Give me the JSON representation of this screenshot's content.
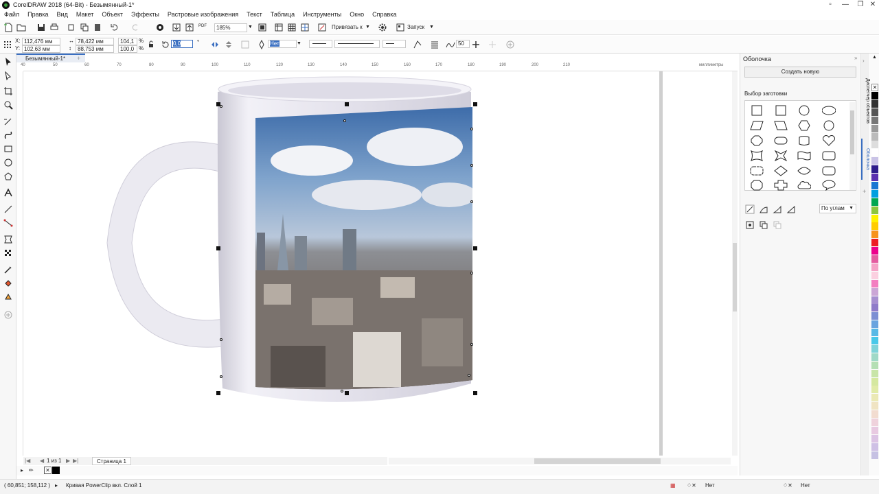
{
  "window": {
    "title": "CorelDRAW 2018 (64-Bit) - Безымянный-1*"
  },
  "menu": [
    "Файл",
    "Правка",
    "Вид",
    "Макет",
    "Объект",
    "Эффекты",
    "Растровые изображения",
    "Текст",
    "Таблица",
    "Инструменты",
    "Окно",
    "Справка"
  ],
  "toolbar1": {
    "zoom": "185%",
    "snap": "Привязать к",
    "launch": "Запуск",
    "pdf": "PDF"
  },
  "toolbar2": {
    "x": "112,476 мм",
    "y": "102,63 мм",
    "x_label": "X:",
    "y_label": "Y:",
    "w": "78,422 мм",
    "h": "88,753 мм",
    "sx": "104,1",
    "sy": "100,0",
    "pct": "%",
    "rot": "0,0",
    "rot_unit": "°",
    "fill_sel": "Нет",
    "smooth": "50"
  },
  "doc_tab": "Безымянный-1*",
  "ruler": {
    "ticks": [
      "40",
      "50",
      "60",
      "70",
      "80",
      "90",
      "100",
      "110",
      "120",
      "130",
      "140",
      "150",
      "160",
      "170",
      "180",
      "190",
      "200",
      "210"
    ],
    "unit": "миллиметры"
  },
  "page_nav": {
    "text": "1 из 1",
    "tab": "Страница 1"
  },
  "status": {
    "coords": "( 60,851; 158,112 )",
    "desc": "Кривая PowerClip вкл. Слой 1",
    "fill": "Нет",
    "outline": "Нет"
  },
  "docker": {
    "title": "Оболочка",
    "create_btn": "Создать новую",
    "presets_label": "Выбор заготовки",
    "mode": "По углам",
    "tabs": [
      "Диспетчер объектов",
      "Оболочка"
    ]
  },
  "palette_colors": [
    "#000000",
    "#333333",
    "#555555",
    "#777777",
    "#999999",
    "#bbbbbb",
    "#dddddd",
    "#ffffff",
    "#c9c3e6",
    "#2e1c8c",
    "#5b2fb0",
    "#1976d2",
    "#00a0e0",
    "#00a651",
    "#8dc63f",
    "#fff200",
    "#ffcc00",
    "#f7941d",
    "#ed1c24",
    "#ec008c",
    "#e45ca0",
    "#f5a3c7",
    "#fbd0e0",
    "#f37ec1",
    "#cba6d6",
    "#a78fd0",
    "#8f7bc9",
    "#7d8fd3",
    "#6aa4df",
    "#58b9e6",
    "#48c8e9",
    "#7fd3d9",
    "#9fd9c7",
    "#b4dfb4",
    "#c8e5a8",
    "#d5e8a0",
    "#e1eba8",
    "#ebe9b5",
    "#f0e4c3",
    "#f2dcd0",
    "#efd2dc",
    "#e8c9e1",
    "#dcc3e4",
    "#cfc0e5",
    "#c6c1e3"
  ]
}
